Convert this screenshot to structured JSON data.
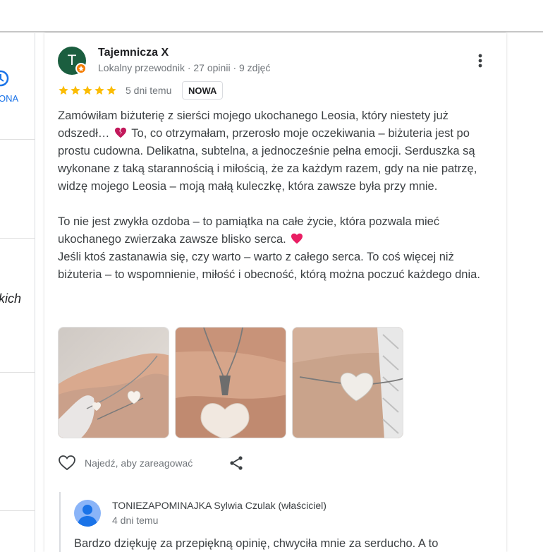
{
  "left_panel": {
    "label_fragment": "ONA",
    "italic_fragment": "kich"
  },
  "review": {
    "author": {
      "initial": "T",
      "name": "Tajemnicza X",
      "meta": "Lokalny przewodnik · 27 opinii · 9 zdjęć"
    },
    "rating": 5,
    "date": "5 dni temu",
    "badge": "NOWA",
    "text": {
      "p1": "Zamówiłam biżuterię z sierści mojego ukochanego Leosia, który niestety już odszedł…",
      "p1b": "To, co otrzymałam, przerosło moje oczekiwania – biżuteria jest po prostu cudowna. Delikatna, subtelna, a jednocześnie pełna emocji. Serduszka są wykonane z taką starannością i miłością, że za każdym razem, gdy na nie patrzę, widzę mojego Leosia – moją małą kuleczkę, która zawsze była przy mnie.",
      "p2": "To nie jest zwykła ozdoba – to pamiątka na całe życie, która pozwala mieć ukochanego zwierzaka zawsze blisko serca.",
      "p3": "Jeśli ktoś zastanawia się, czy warto – warto z całego serca. To coś więcej niż biżuteria – to wspomnienie, miłość i obecność, którą można poczuć każdego dnia."
    },
    "photos": [
      "bracelet-with-heart-photo",
      "necklace-heart-pendant-photo",
      "bracelet-heart-closeup-photo"
    ],
    "actions": {
      "react_label": "Najedź, aby zareagować"
    }
  },
  "owner_reply": {
    "name": "TONIEZAPOMINAJKA Sylwia Czulak (właściciel)",
    "date": "4 dni temu",
    "text": "Bardzo dziękuję za przepiękną opinię, chwyciła mnie za serducho. A to"
  },
  "colors": {
    "star": "#fbbc04",
    "avatar": "#1b5e3f",
    "link_blue": "#1a73e8",
    "heart_pink": "#e91e63",
    "broken_heart": "#c2185b"
  }
}
